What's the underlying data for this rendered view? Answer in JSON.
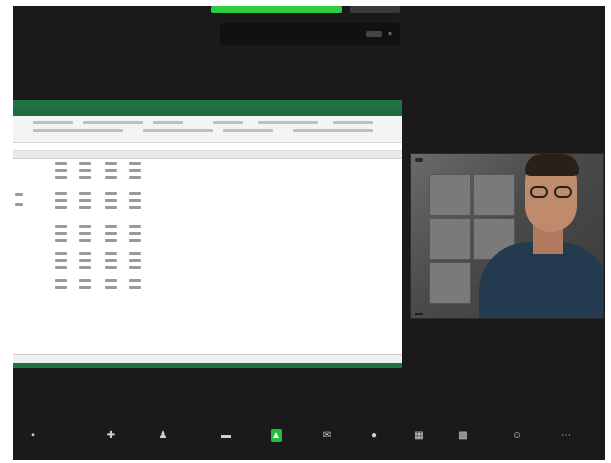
{
  "meeting": {
    "notice_text": "",
    "notice_button": "",
    "notice_close": "×"
  },
  "spreadsheet": {
    "title": ""
  },
  "camera": {
    "tag": "",
    "name": ""
  },
  "toolbar": [
    {
      "name": "unmute-video",
      "icon": "▪",
      "label": "",
      "highlight": false
    },
    {
      "name": "security",
      "icon": "✚",
      "label": "",
      "highlight": false
    },
    {
      "name": "participants",
      "icon": "♟",
      "label": "",
      "highlight": false
    },
    {
      "name": "chat",
      "icon": "▬",
      "label": "",
      "highlight": false
    },
    {
      "name": "share-screen",
      "icon": "▲",
      "label": "",
      "highlight": true
    },
    {
      "name": "new-share",
      "icon": "✉",
      "label": "",
      "highlight": false
    },
    {
      "name": "record",
      "icon": "●",
      "label": "",
      "highlight": false
    },
    {
      "name": "show-captions",
      "icon": "▦",
      "label": "",
      "highlight": false
    },
    {
      "name": "breakout-rooms",
      "icon": "▩",
      "label": "",
      "highlight": false
    },
    {
      "name": "apps",
      "icon": "☺",
      "label": "",
      "highlight": false
    },
    {
      "name": "more",
      "icon": "⋯",
      "label": "",
      "highlight": false
    }
  ],
  "colors": {
    "share_accent": "#2ecc40",
    "excel_green": "#217346"
  }
}
